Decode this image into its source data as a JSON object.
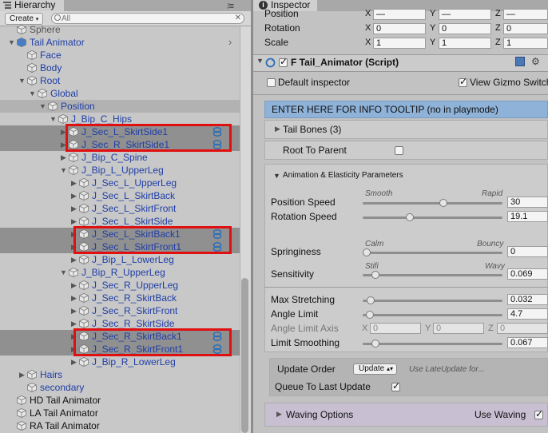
{
  "hierarchy": {
    "tab_title": "Hierarchy",
    "create_label": "Create",
    "search_placeholder": "All",
    "items": [
      {
        "label": "Sphere",
        "color": "gray"
      },
      {
        "label": "Tail Animator",
        "color": "blue"
      },
      {
        "label": "Face",
        "color": "blue"
      },
      {
        "label": "Body",
        "color": "blue"
      },
      {
        "label": "Root",
        "color": "blue"
      },
      {
        "label": "Global",
        "color": "blue"
      },
      {
        "label": "Position",
        "color": "blue"
      },
      {
        "label": "J_Bip_C_Hips",
        "color": "blue"
      },
      {
        "label": "J_Sec_L_SkirtSide1",
        "color": "blue"
      },
      {
        "label": "J_Sec_R_SkirtSide1",
        "color": "blue"
      },
      {
        "label": "J_Bip_C_Spine",
        "color": "blue"
      },
      {
        "label": "J_Bip_L_UpperLeg",
        "color": "blue"
      },
      {
        "label": "J_Sec_L_UpperLeg",
        "color": "blue"
      },
      {
        "label": "J_Sec_L_SkirtBack",
        "color": "blue"
      },
      {
        "label": "J_Sec_L_SkirtFront",
        "color": "blue"
      },
      {
        "label": "J_Sec_L_SkirtSide",
        "color": "blue"
      },
      {
        "label": "J_Sec_L_SkirtBack1",
        "color": "blue"
      },
      {
        "label": "J_Sec_L_SkirtFront1",
        "color": "blue"
      },
      {
        "label": "J_Bip_L_LowerLeg",
        "color": "blue"
      },
      {
        "label": "J_Bip_R_UpperLeg",
        "color": "blue"
      },
      {
        "label": "J_Sec_R_UpperLeg",
        "color": "blue"
      },
      {
        "label": "J_Sec_R_SkirtBack",
        "color": "blue"
      },
      {
        "label": "J_Sec_R_SkirtFront",
        "color": "blue"
      },
      {
        "label": "J_Sec_R_SkirtSide",
        "color": "blue"
      },
      {
        "label": "J_Sec_R_SkirtBack1",
        "color": "blue"
      },
      {
        "label": "J_Sec_R_SkirtFront1",
        "color": "blue"
      },
      {
        "label": "J_Bip_R_LowerLeg",
        "color": "blue"
      },
      {
        "label": "Hairs",
        "color": "blue"
      },
      {
        "label": "secondary",
        "color": "blue"
      },
      {
        "label": "HD Tail Animator",
        "color": "black"
      },
      {
        "label": "LA Tail Animator",
        "color": "black"
      },
      {
        "label": "RA Tail Animator",
        "color": "black"
      }
    ]
  },
  "inspector": {
    "tab_title": "Inspector",
    "transform": {
      "position_label": "Position",
      "rotation_label": "Rotation",
      "scale_label": "Scale",
      "axes": [
        "X",
        "Y",
        "Z"
      ],
      "position": [
        "—",
        "—",
        "—"
      ],
      "rotation": [
        "0",
        "0",
        "0"
      ],
      "scale": [
        "1",
        "1",
        "1"
      ]
    },
    "component": {
      "title": "F Tail_Animator (Script)",
      "default_inspector": "Default inspector",
      "view_gizmo": "View Gizmo Switch",
      "tooltip_bar": "ENTER HERE FOR INFO TOOLTIP (no in playmode)",
      "tail_bones": "Tail Bones (3)",
      "root_to_parent": "Root To Parent",
      "section_title": "Animation & Elasticity Parameters",
      "position_speed": {
        "label": "Position Speed",
        "min_label": "Smooth",
        "max_label": "Rapid",
        "value": "30",
        "fraction": 0.58
      },
      "rotation_speed": {
        "label": "Rotation Speed",
        "value": "19.1",
        "fraction": 0.33
      },
      "springiness": {
        "label": "Springiness",
        "min_label": "Calm",
        "max_label": "Bouncy",
        "value": "0",
        "fraction": 0.0
      },
      "sensitivity": {
        "label": "Sensitivity",
        "min_label": "Stifi",
        "max_label": "Wavy",
        "value": "0.069",
        "fraction": 0.069
      },
      "max_stretching": {
        "label": "Max Stretching",
        "value": "0.032",
        "fraction": 0.032
      },
      "angle_limit": {
        "label": "Angle Limit",
        "value": "4.7",
        "fraction": 0.026
      },
      "angle_limit_axis": {
        "label": "Angle Limit Axis",
        "x": "0",
        "y": "0",
        "z": "0"
      },
      "limit_smoothing": {
        "label": "Limit Smoothing",
        "value": "0.067",
        "fraction": 0.067
      },
      "update_order": {
        "label": "Update Order",
        "value": "Update",
        "hint": "Use LateUpdate for..."
      },
      "queue_last": "Queue To Last Update",
      "waving_options": "Waving Options",
      "use_waving": "Use Waving"
    }
  }
}
